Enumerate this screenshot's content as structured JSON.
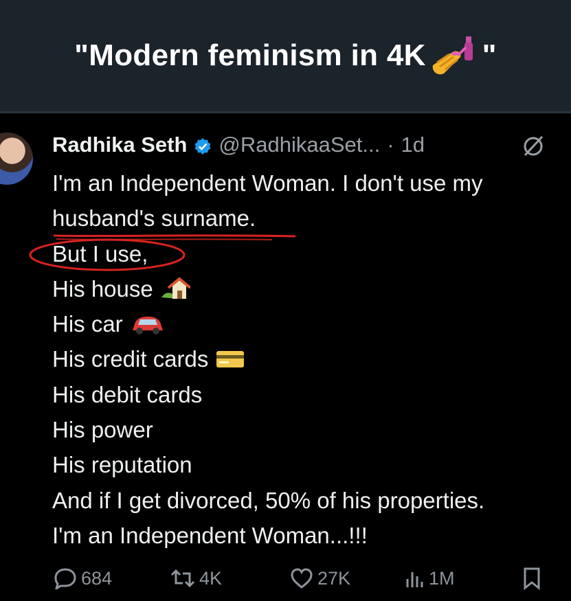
{
  "banner": {
    "title": "\"Modern feminism in 4K",
    "closing_quote": "\"",
    "emoji": "nail-polish-emoji"
  },
  "tweet": {
    "author_name": "Radhika Seth",
    "verified": true,
    "handle": "@RadhikaaSet...",
    "separator": "·",
    "timestamp": "1d",
    "lines": [
      "I'm an Independent Woman.  I don't use my",
      "husband's surname.",
      "But I use,",
      "His house",
      "His car",
      "His credit cards",
      "His debit cards",
      "His power",
      "His reputation",
      "And if I get divorced, 50% of his properties.",
      "I'm an Independent Woman...!!!"
    ],
    "annotations": {
      "underline_color": "#d8231f",
      "circle_color": "#d8231f"
    }
  },
  "actions": {
    "replies": "684",
    "reposts": "4K",
    "likes": "27K",
    "views": "1M"
  },
  "colors": {
    "banner_bg": "#1b232b",
    "tweet_bg": "#000000",
    "text": "#e7e9ea",
    "muted": "#9aa0a6",
    "verified": "#1d9bf0"
  }
}
